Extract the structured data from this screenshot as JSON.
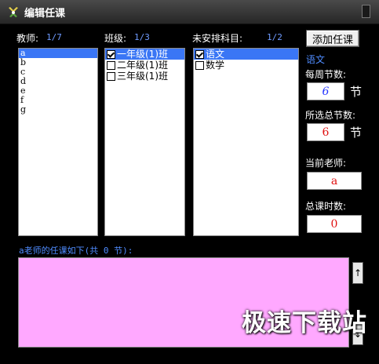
{
  "window": {
    "title": "编辑任课"
  },
  "teachers": {
    "label": "教师:",
    "count": "1/7",
    "items": [
      "a",
      "b",
      "c",
      "d",
      "e",
      "f",
      "g"
    ],
    "selected_index": 0
  },
  "classes": {
    "label": "班级:",
    "count": "1/3",
    "items": [
      {
        "label": "一年级(1)班",
        "checked": true,
        "selected": true
      },
      {
        "label": "二年级(1)班",
        "checked": false,
        "selected": false
      },
      {
        "label": "三年级(1)班",
        "checked": false,
        "selected": false
      }
    ]
  },
  "subjects": {
    "label": "未安排科目:",
    "count": "1/2",
    "items": [
      {
        "label": "语文",
        "checked": true,
        "selected": true
      },
      {
        "label": "数学",
        "checked": false,
        "selected": false
      }
    ]
  },
  "side": {
    "add_button": "添加任课",
    "current_subject": "语文",
    "weekly_label": "每周节数:",
    "weekly_value": "6",
    "weekly_unit": "节",
    "total_label": "所选总节数:",
    "total_value": "6",
    "total_unit": "节",
    "teacher_label": "当前老师:",
    "teacher_value": "a",
    "hours_label": "总课时数:",
    "hours_value": "0"
  },
  "summary": {
    "label": "a老师的任课如下(共 0 节):",
    "scroll_up": "↑",
    "scroll_down": "↓"
  },
  "watermark": "极速下载站",
  "colors": {
    "selection": "#3a76f5",
    "accent_text": "#4f8cff",
    "summary_bg": "#ffa8ff",
    "weekly_value": "#2233ff",
    "value_red": "#e01010"
  }
}
